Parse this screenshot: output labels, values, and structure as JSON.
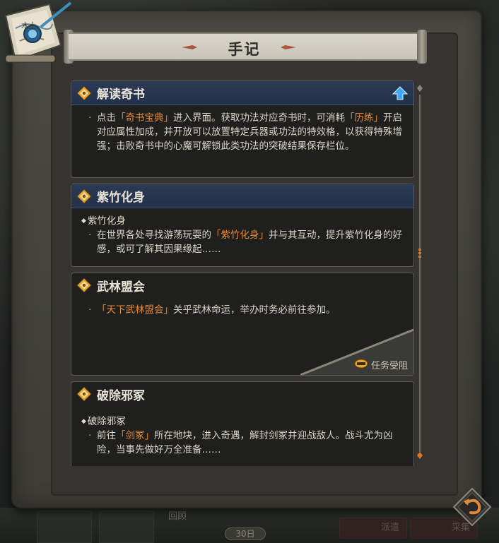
{
  "panel": {
    "title": "手记"
  },
  "cards": [
    {
      "title": "解读奇书",
      "active": true,
      "body_parts": [
        "点击",
        "「奇书宝典」",
        "进入界面。获取功法对应奇书时，可消耗",
        "「历练」",
        "开启对应属性加成，并开放可以放置特定兵器或功法的特效格，以获得特殊增强；击败奇书中的心魔可解锁此类功法的突破结果保存栏位。"
      ]
    },
    {
      "title": "紫竹化身",
      "active": true,
      "subtitle": "紫竹化身",
      "body_parts": [
        "在世界各处寻找游荡玩耍的",
        "「紫竹化身」",
        "并与其互动，提升紫竹化身的好感，或可了解其因果缘起……"
      ]
    },
    {
      "title": "武林盟会",
      "active": false,
      "body_parts": [
        "「天下武林盟会」",
        "关乎武林命运，举办时务必前往参加。"
      ],
      "status": "任务受阻"
    },
    {
      "title": "破除邪冢",
      "active": false,
      "subtitle": "破除邪冢",
      "body_parts": [
        "前往",
        "「剑冢」",
        "所在地块，进入奇遇，解封剑冢并迎战敌人。战斗尤为凶险，当事先做好万全准备……"
      ]
    }
  ],
  "bottom": {
    "review_label": "回顾",
    "day_label": "30日",
    "dispatch_label": "派遣",
    "gather_label": "采集"
  },
  "colors": {
    "highlight": "#e58a3c",
    "active_header": "#2c3a55",
    "arrow": "#3fa9f5"
  }
}
